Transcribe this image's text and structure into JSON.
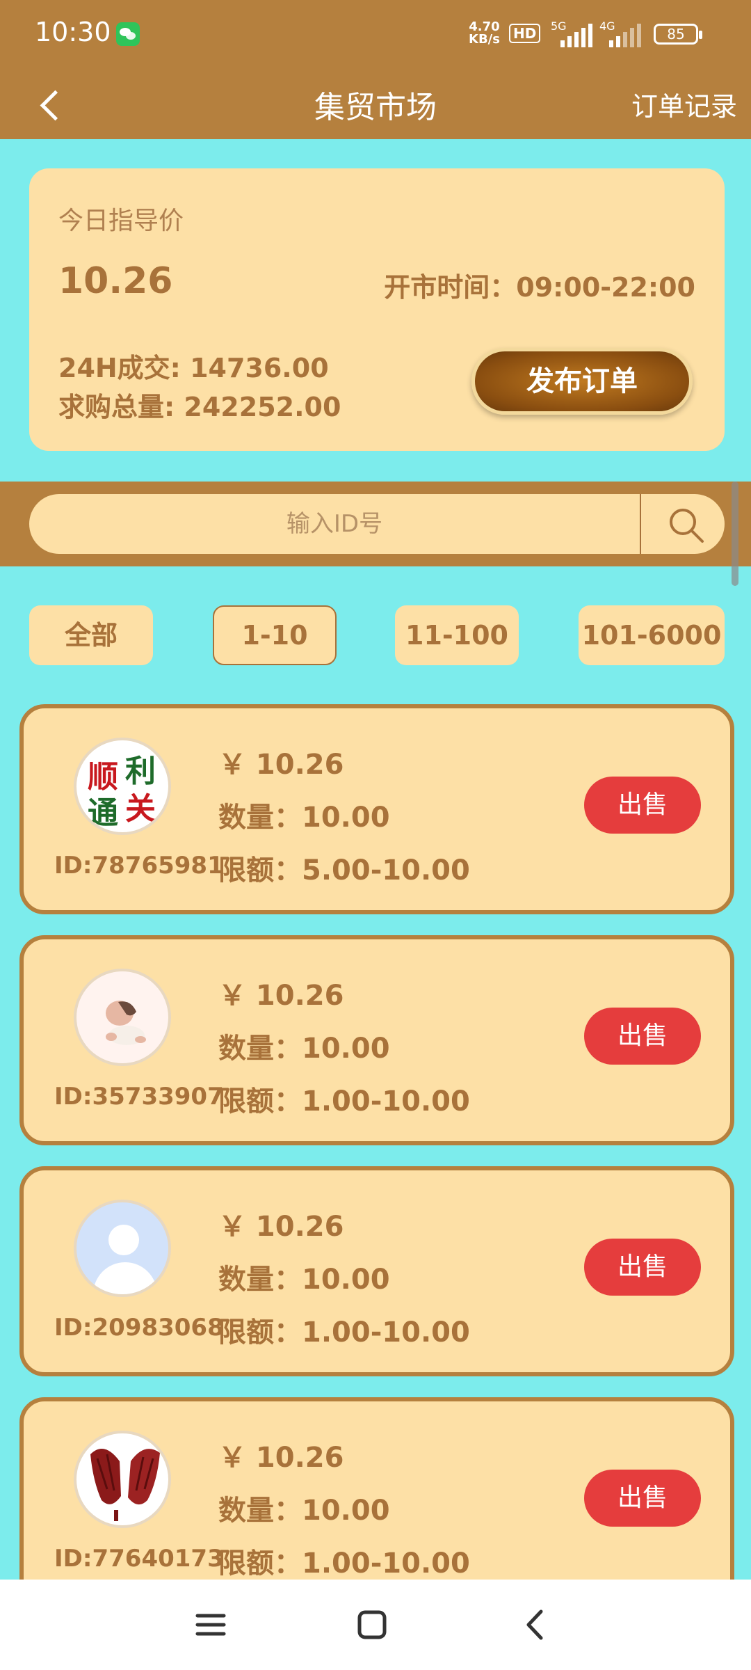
{
  "status_bar": {
    "time": "10:30",
    "net_speed_value": "4.70",
    "net_speed_unit": "KB/s",
    "hd_label": "HD",
    "signal1_label": "5G",
    "signal2_label": "4G",
    "battery": "85"
  },
  "header": {
    "title": "集贸市场",
    "records_label": "订单记录"
  },
  "info": {
    "guide_price_label": "今日指导价",
    "guide_price": "10.26",
    "market_hours": "开市时间：09:00-22:00",
    "volume_24h": "24H成交: 14736.00",
    "total_demand": "求购总量: 242252.00",
    "publish_button": "发布订单"
  },
  "search": {
    "placeholder": "输入ID号"
  },
  "filters": [
    {
      "label": "全部",
      "active": false
    },
    {
      "label": "1-10",
      "active": true
    },
    {
      "label": "11-100",
      "active": false
    },
    {
      "label": "101-6000",
      "active": false
    }
  ],
  "listings": [
    {
      "id": "ID:78765981",
      "price": "￥ 10.26",
      "qty": "数量：10.00",
      "limit": "限额：5.00-10.00",
      "sell": "出售",
      "avatar_chars": [
        "顺",
        "利",
        "通",
        "关"
      ]
    },
    {
      "id": "ID:35733907",
      "price": "￥ 10.26",
      "qty": "数量：10.00",
      "limit": "限额：1.00-10.00",
      "sell": "出售"
    },
    {
      "id": "ID:20983068",
      "price": "￥ 10.26",
      "qty": "数量：10.00",
      "limit": "限额：1.00-10.00",
      "sell": "出售"
    },
    {
      "id": "ID:77640173",
      "price": "￥ 10.26",
      "qty": "数量：10.00",
      "limit": "限额：1.00-10.00",
      "sell": "出售"
    }
  ],
  "colors": {
    "header_bg": "#b5803e",
    "page_bg": "#7cecec",
    "card_bg": "#fde0a6",
    "sell_button": "#e53d3d",
    "text_brown": "#a8723a"
  }
}
